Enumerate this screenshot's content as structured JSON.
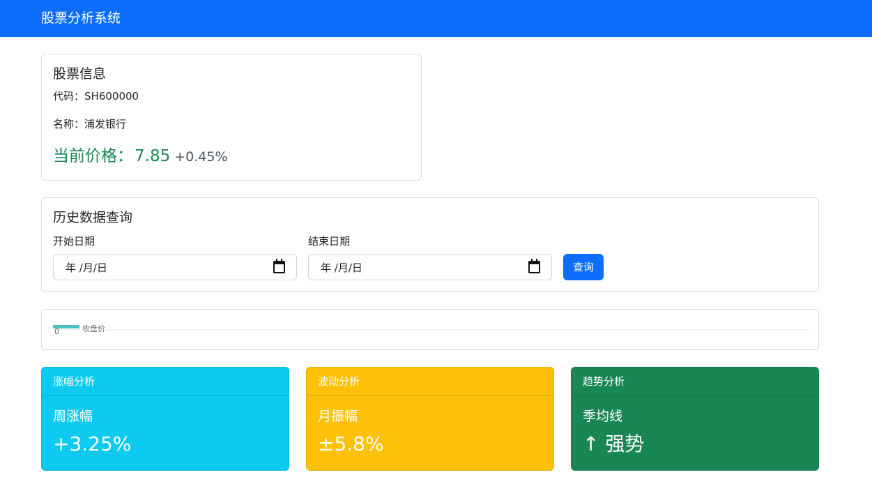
{
  "navbar": {
    "brand": "股票分析系统"
  },
  "stock_info": {
    "title": "股票信息",
    "code_label": "代码：",
    "code": "SH600000",
    "name_label": "名称：",
    "name": "浦发银行",
    "price_label": "当前价格：",
    "price": "7.85",
    "change": "+0.45%"
  },
  "history_query": {
    "title": "历史数据查询",
    "start_label": "开始日期",
    "start_value": "年 /月/日",
    "end_label": "结束日期",
    "end_value": "年 /月/日",
    "query_button": "查询"
  },
  "chart_data": {
    "type": "line",
    "series": [
      {
        "name": "收盘价",
        "values": []
      }
    ],
    "tick_labels": [
      "0"
    ],
    "color": "#4bc0c0"
  },
  "analysis": [
    {
      "header": "涨幅分析",
      "sub": "周涨幅",
      "value": "+3.25%",
      "color": "#0dcaf0"
    },
    {
      "header": "波动分析",
      "sub": "月振幅",
      "value": "±5.8%",
      "color": "#ffc107"
    },
    {
      "header": "趋势分析",
      "sub": "季均线",
      "value": "↑ 强势",
      "color": "#198754"
    }
  ]
}
